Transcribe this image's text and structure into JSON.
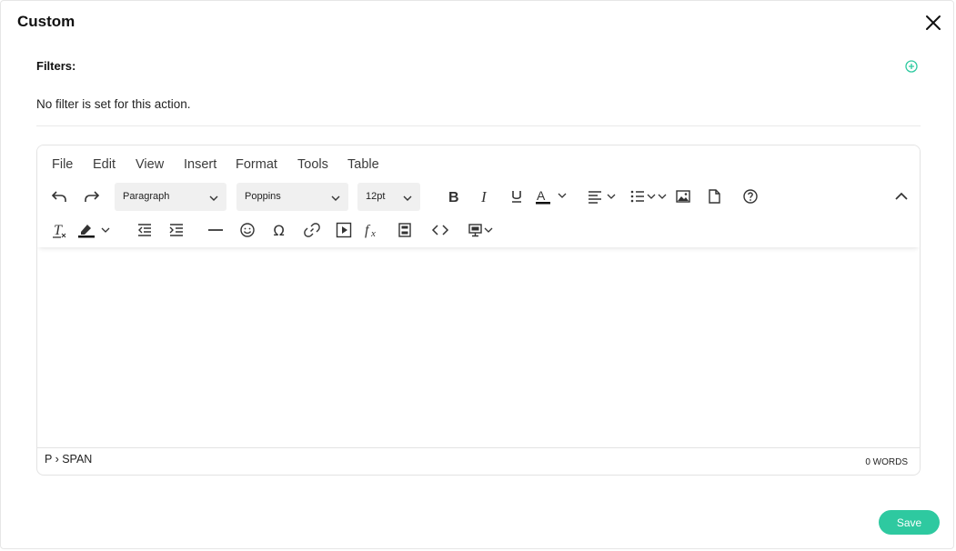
{
  "dialog": {
    "title": "Custom",
    "filters_label": "Filters:",
    "no_filter_text": "No filter is set for this action.",
    "save_label": "Save",
    "accent_color": "#2ec9a0"
  },
  "editor": {
    "menu": [
      "File",
      "Edit",
      "View",
      "Insert",
      "Format",
      "Tools",
      "Table"
    ],
    "block_format": "Paragraph",
    "font_family": "Poppins",
    "font_size": "12pt",
    "underline_color_label": "A",
    "path": "P › SPAN",
    "word_count": "0 WORDS",
    "icons_row1": [
      "undo-icon",
      "redo-icon",
      "bold-icon",
      "italic-icon",
      "underline-icon",
      "text-color-icon",
      "align-icon",
      "bullet-list-icon",
      "image-icon",
      "document-icon",
      "help-icon",
      "collapse-icon"
    ],
    "icons_row2": [
      "clear-format-icon",
      "highlight-icon",
      "outdent-icon",
      "indent-icon",
      "horizontal-rule-icon",
      "emoji-icon",
      "special-char-icon",
      "link-icon",
      "media-icon",
      "formula-icon",
      "template-icon",
      "code-icon",
      "preview-icon"
    ]
  }
}
